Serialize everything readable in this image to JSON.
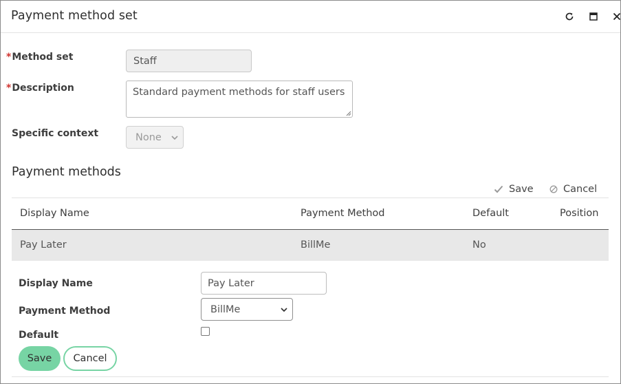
{
  "dialog": {
    "title": "Payment method set",
    "controls": [
      "refresh-icon",
      "maximize-icon",
      "close-icon"
    ]
  },
  "form": {
    "method_set": {
      "required_mark": "*",
      "label": "Method set",
      "value": "Staff"
    },
    "description": {
      "required_mark": "*",
      "label": "Description",
      "value": "Standard payment methods for staff users"
    },
    "specific_context": {
      "label": "Specific context",
      "value": "None"
    }
  },
  "payment_methods": {
    "title": "Payment methods",
    "actions": {
      "save": "Save",
      "cancel": "Cancel"
    },
    "columns": [
      "Display Name",
      "Payment Method",
      "Default",
      "Position"
    ],
    "rows": [
      {
        "display_name": "Pay Later",
        "payment_method": "BillMe",
        "default": "No",
        "position": ""
      }
    ]
  },
  "editor": {
    "display_name": {
      "label": "Display Name",
      "value": "Pay Later"
    },
    "payment_method": {
      "label": "Payment Method",
      "value": "BillMe"
    },
    "default": {
      "label": "Default",
      "checked": false
    },
    "save_label": "Save",
    "cancel_label": "Cancel"
  },
  "colors": {
    "accent": "#77d4a4",
    "required": "#d0312d",
    "selected_row": "#e8e8e8"
  }
}
